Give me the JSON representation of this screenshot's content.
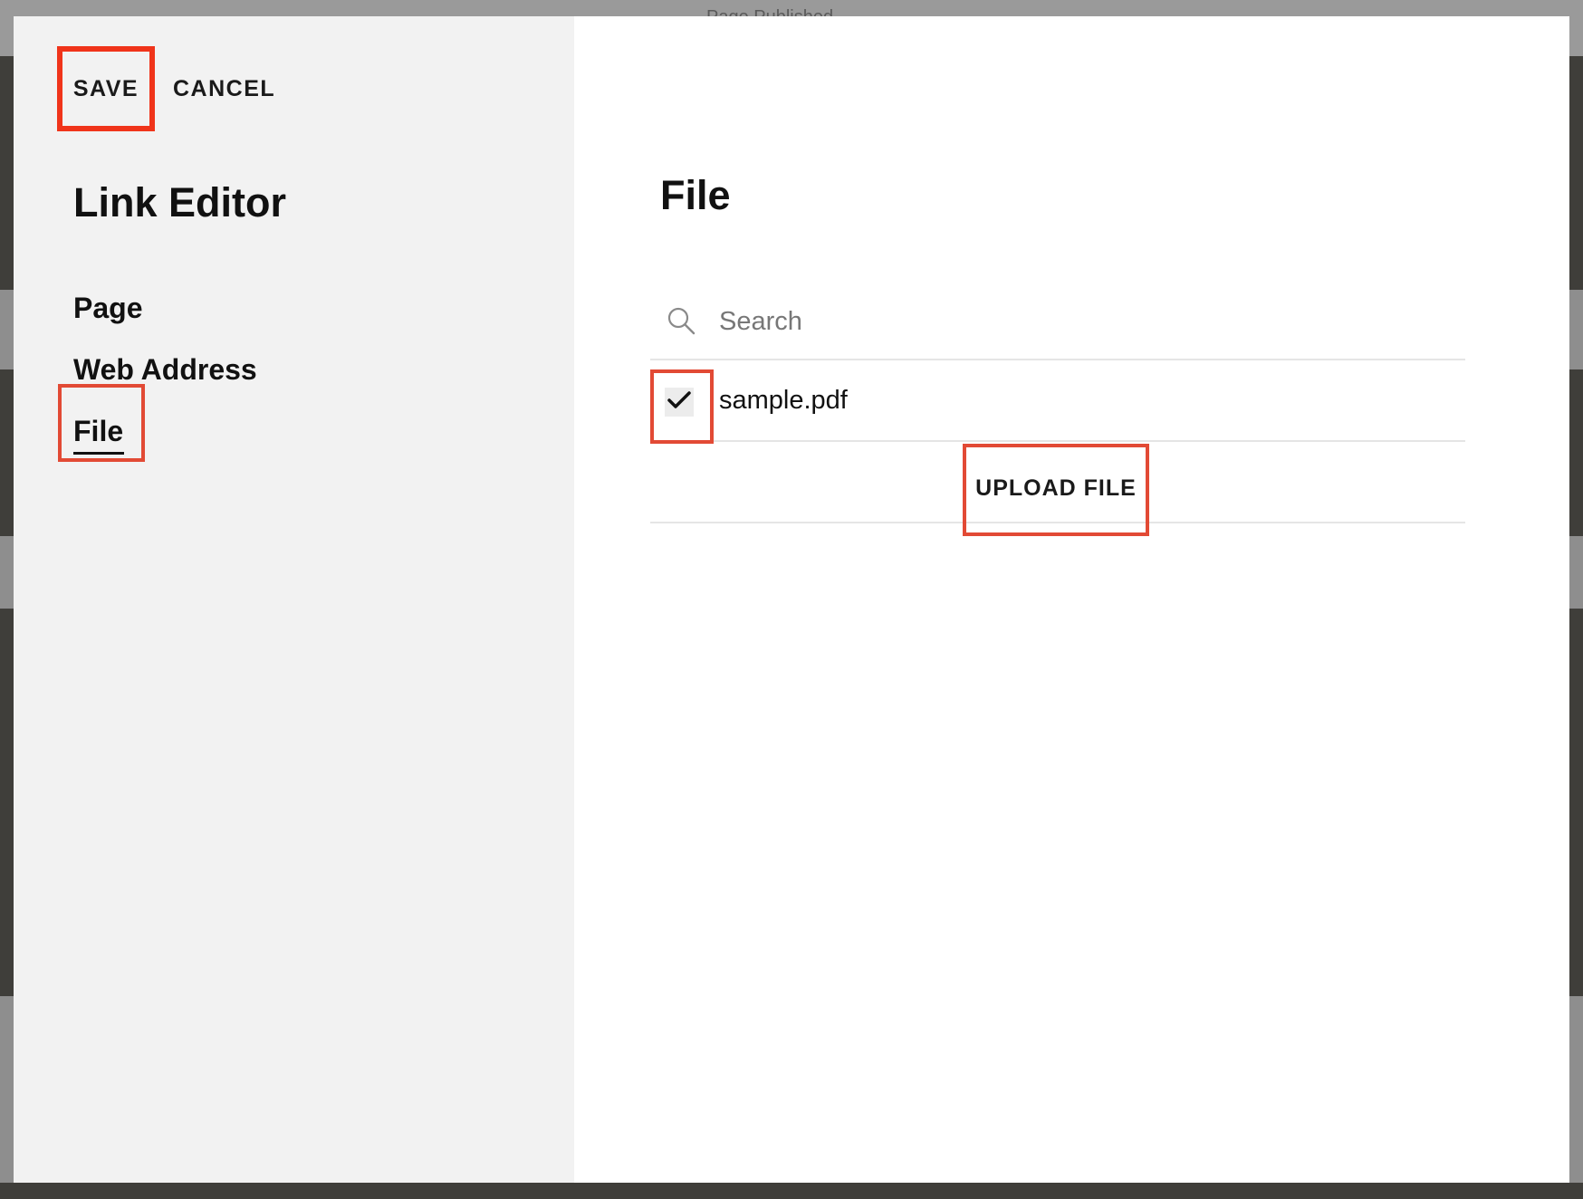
{
  "backdrop": {
    "top_text": "Page Published"
  },
  "toolbar": {
    "save_label": "SAVE",
    "cancel_label": "CANCEL"
  },
  "sidebar": {
    "title": "Link Editor",
    "items": [
      {
        "label": "Page"
      },
      {
        "label": "Web Address"
      },
      {
        "label": "File"
      }
    ],
    "active_item": "File"
  },
  "main": {
    "title": "File",
    "search": {
      "placeholder": "Search",
      "value": ""
    },
    "files": [
      {
        "name": "sample.pdf",
        "checked": true
      }
    ],
    "upload_label": "UPLOAD FILE"
  },
  "colors": {
    "highlight": "#e24a35",
    "save_highlight": "#f0341a",
    "sidebar_bg": "#f2f2f2",
    "backdrop": "#3f3e3a"
  },
  "icons": {
    "search": "search-icon",
    "check": "check-icon"
  }
}
